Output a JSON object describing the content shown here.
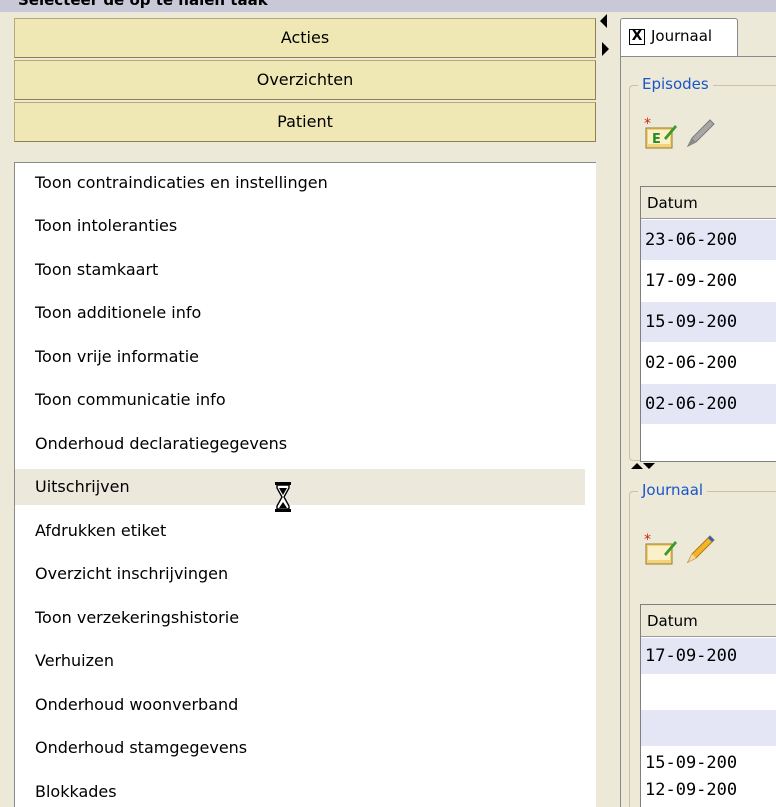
{
  "window": {
    "caption": "Selecteer de op te halen taak"
  },
  "accordion": {
    "acties": "Acties",
    "overzichten": "Overzichten",
    "patient": "Patient"
  },
  "menu": {
    "items": [
      "Toon contraindicaties en instellingen",
      "Toon intoleranties",
      "Toon stamkaart",
      "Toon additionele info",
      "Toon vrije informatie",
      "Toon communicatie info",
      "Onderhoud declaratiegegevens",
      "Uitschrijven",
      "Afdrukken etiket",
      "Overzicht inschrijvingen",
      "Toon verzekeringshistorie",
      "Verhuizen",
      "Onderhoud woonverband",
      "Onderhoud stamgegevens",
      "Blokkades"
    ],
    "hover_index": 7
  },
  "tab": {
    "close": "X",
    "label": "Journaal"
  },
  "episodes": {
    "legend": "Episodes",
    "header": "Datum",
    "rows": [
      "23-06-200",
      "17-09-200",
      "15-09-200",
      "02-06-200",
      "02-06-200"
    ]
  },
  "journaal": {
    "legend": "Journaal",
    "header": "Datum",
    "rows": [
      "17-09-200",
      "",
      "",
      "15-09-200",
      "12-09-200"
    ]
  },
  "colors": {
    "accordion_bg": "#f0e8b4",
    "legend_text": "#1a55c8",
    "alt_row": "#e4e6f6",
    "hover_row": "#ece9dc"
  },
  "icons": {
    "new_episode": "new-document-star-icon",
    "edit_disabled": "pencil-disabled-icon",
    "new_journal": "new-document-star-icon",
    "edit": "pencil-icon",
    "busy": "hourglass-icon"
  }
}
